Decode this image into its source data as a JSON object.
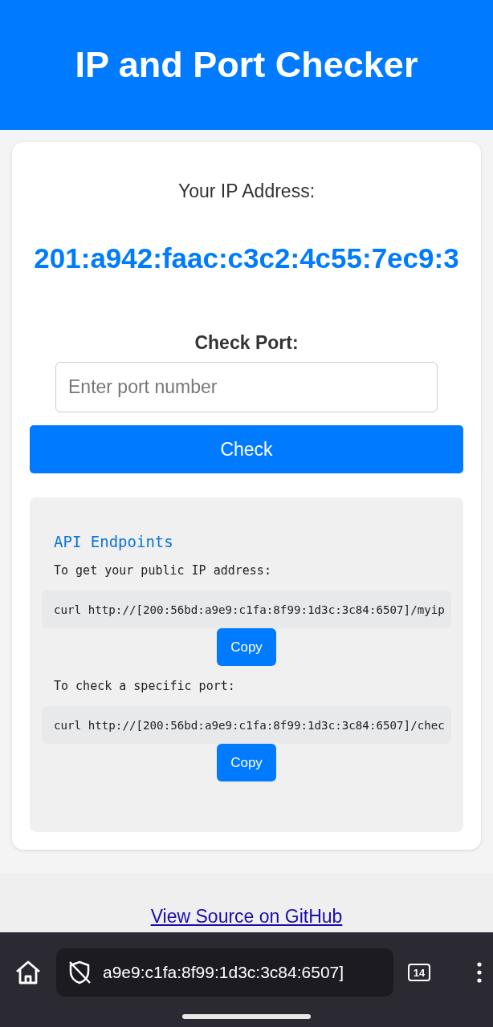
{
  "header": {
    "title": "IP and Port Checker"
  },
  "ip": {
    "label": "Your IP Address:",
    "value": "201:a942:faac:c3c2:4c55:7ec9:3"
  },
  "port": {
    "label": "Check Port:",
    "placeholder": "Enter port number",
    "button": "Check"
  },
  "api": {
    "title": "API Endpoints",
    "endpoints": [
      {
        "description": "To get your public IP address:",
        "command": "curl http://[200:56bd:a9e9:c1fa:8f99:1d3c:3c84:6507]/myip",
        "button": "Copy"
      },
      {
        "description": "To check a specific port:",
        "command": "curl http://[200:56bd:a9e9:c1fa:8f99:1d3c:3c84:6507]/chec",
        "button": "Copy"
      }
    ]
  },
  "footer": {
    "link": "View Source on GitHub"
  },
  "browser": {
    "url": "a9e9:c1fa:8f99:1d3c:3c84:6507]",
    "tab_count": "14"
  }
}
